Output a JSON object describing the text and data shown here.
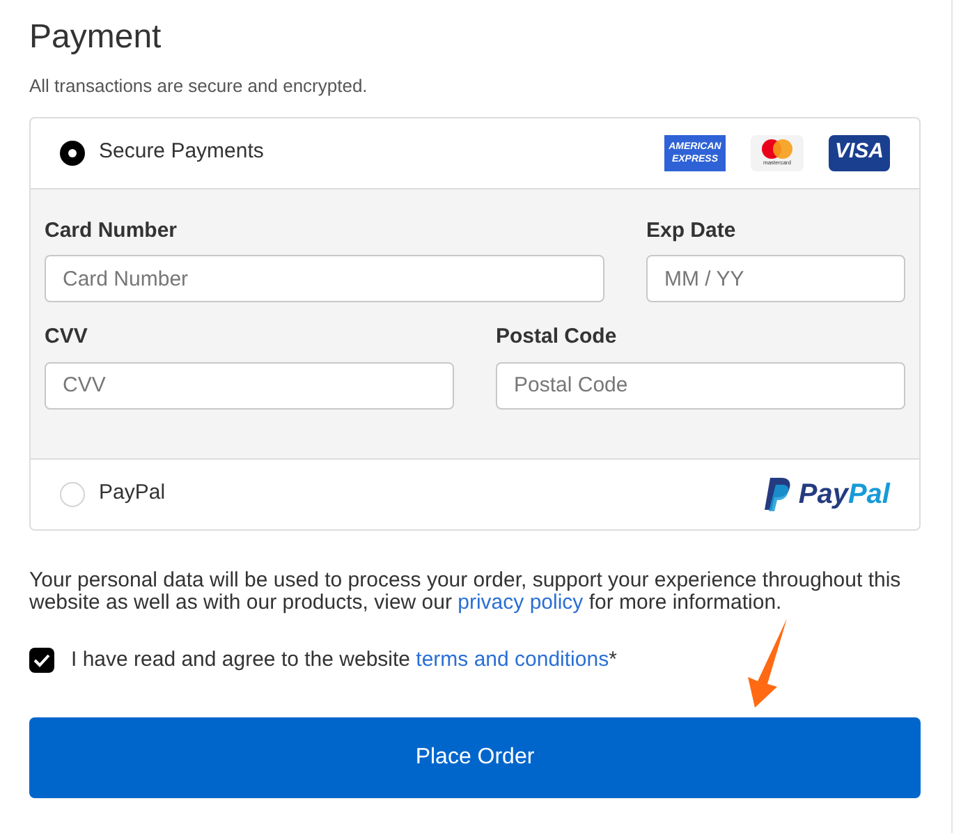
{
  "title": "Payment",
  "subtitle": "All transactions are secure and encrypted.",
  "methods": [
    {
      "kind": "card",
      "label": "Secure Payments",
      "selected": true,
      "logos": [
        "AMERICAN",
        "EXPRESS",
        "mastercard",
        "VISA"
      ],
      "fields": [
        {
          "label": "Card Number",
          "placeholder": "Card Number"
        },
        {
          "label": "Exp Date",
          "placeholder": "MM / YY"
        },
        {
          "label": "CVV",
          "placeholder": "CVV"
        },
        {
          "label": "Postal Code",
          "placeholder": "Postal Code"
        }
      ]
    },
    {
      "kind": "paypal",
      "label": "PayPal",
      "selected": false,
      "logos": [
        "Pay",
        "Pal"
      ]
    }
  ],
  "privacy": {
    "before": "Your personal data will be used to process your order, support your experience throughout this website as well as with our products, view our ",
    "link": "privacy policy",
    "after": " for more information."
  },
  "terms": {
    "checked": true,
    "before": "I have read and agree to the website ",
    "link": "terms and conditions",
    "after": "*"
  },
  "button": "Place Order"
}
